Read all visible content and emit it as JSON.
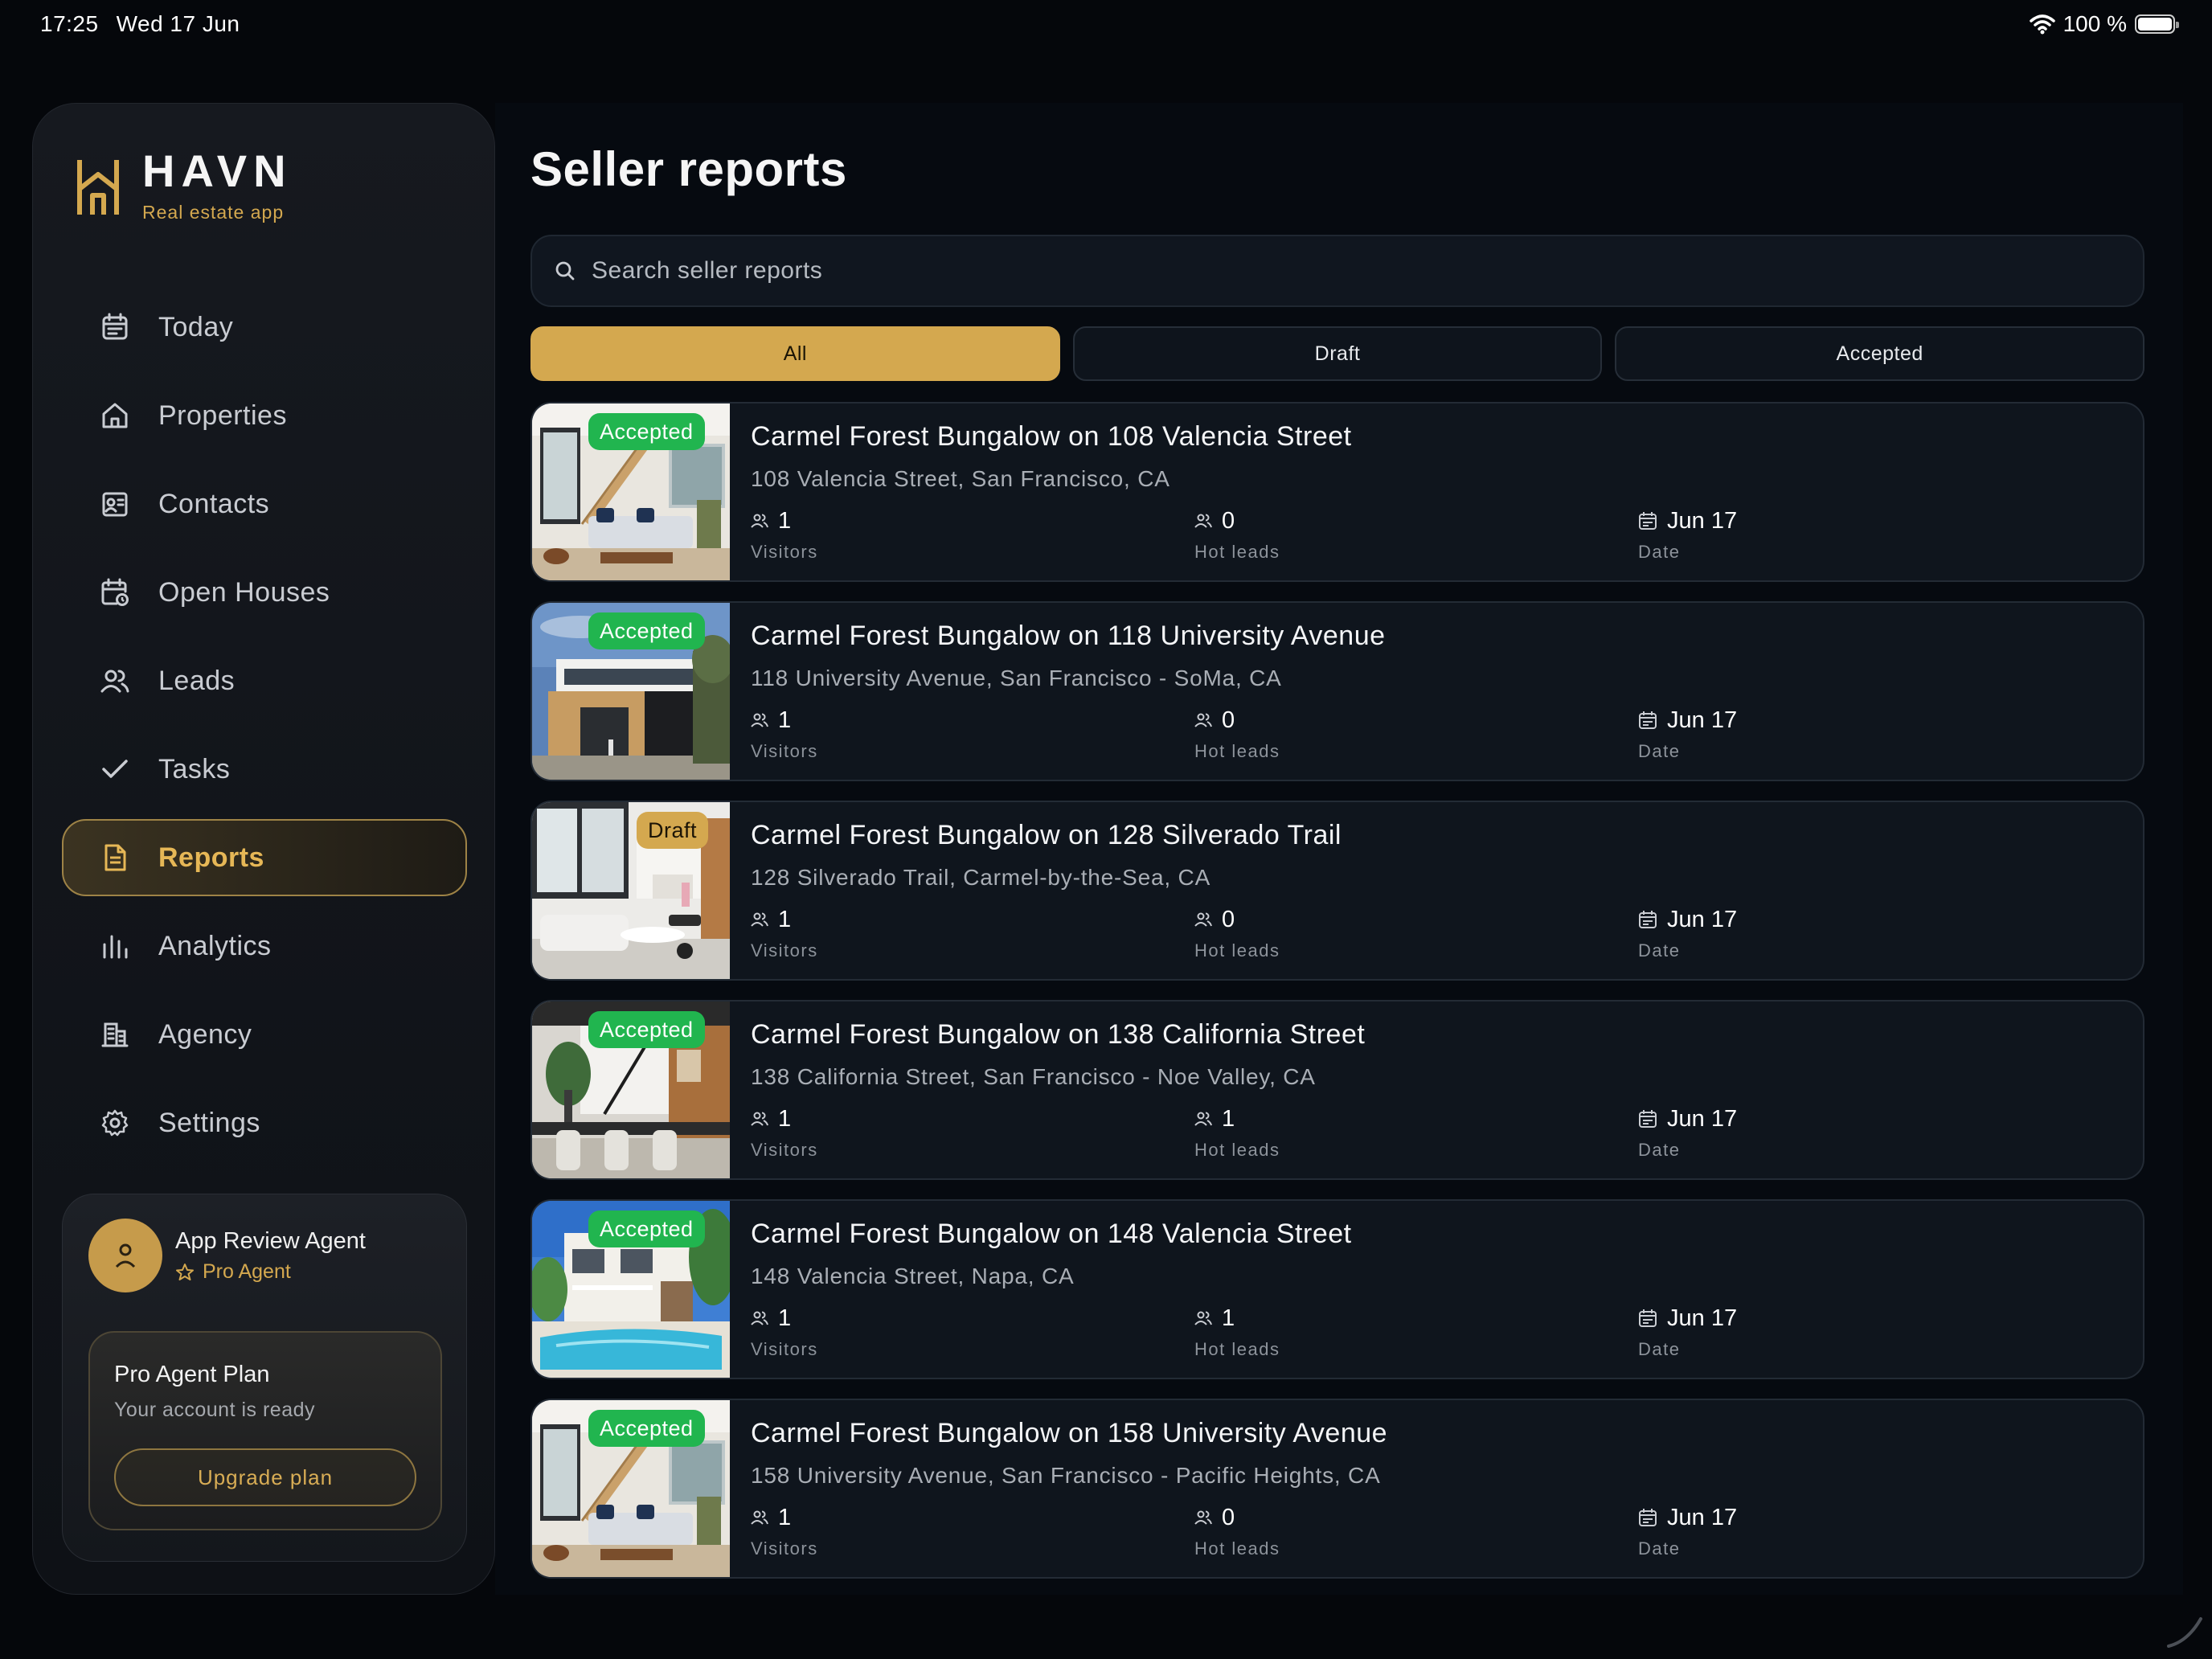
{
  "status_bar": {
    "time": "17:25",
    "date": "Wed 17 Jun",
    "battery": "100 %"
  },
  "brand": {
    "name": "HAVN",
    "tagline": "Real estate app"
  },
  "nav": [
    {
      "label": "Today",
      "icon": "calendar-icon"
    },
    {
      "label": "Properties",
      "icon": "home-icon"
    },
    {
      "label": "Contacts",
      "icon": "contact-card-icon"
    },
    {
      "label": "Open Houses",
      "icon": "calendar-clock-icon"
    },
    {
      "label": "Leads",
      "icon": "users-icon"
    },
    {
      "label": "Tasks",
      "icon": "check-icon"
    },
    {
      "label": "Reports",
      "icon": "document-icon",
      "active": true
    },
    {
      "label": "Analytics",
      "icon": "bar-chart-icon"
    },
    {
      "label": "Agency",
      "icon": "building-icon"
    },
    {
      "label": "Settings",
      "icon": "gear-icon"
    }
  ],
  "account": {
    "name": "App Review Agent",
    "role": "Pro Agent",
    "plan_title": "Pro Agent Plan",
    "plan_subtitle": "Your account is ready",
    "plan_button": "Upgrade plan"
  },
  "main": {
    "title": "Seller reports",
    "search_placeholder": "Search seller reports",
    "tabs": [
      {
        "label": "All",
        "active": true
      },
      {
        "label": "Draft"
      },
      {
        "label": "Accepted"
      }
    ],
    "stat_labels": {
      "visitors": "Visitors",
      "hot_leads": "Hot leads",
      "date": "Date"
    },
    "reports": [
      {
        "status": "Accepted",
        "title": "Carmel Forest Bungalow on 108 Valencia Street",
        "address": "108 Valencia Street, San Francisco, CA",
        "visitors": "1",
        "hot_leads": "0",
        "date": "Jun 17",
        "photo": "interior-staircase-livingroom"
      },
      {
        "status": "Accepted",
        "title": "Carmel Forest Bungalow on 118 University Avenue",
        "address": "118 University Avenue, San Francisco - SoMa, CA",
        "visitors": "1",
        "hot_leads": "0",
        "date": "Jun 17",
        "photo": "modern-house-exterior"
      },
      {
        "status": "Draft",
        "title": "Carmel Forest Bungalow on 128 Silverado Trail",
        "address": "128 Silverado Trail, Carmel-by-the-Sea, CA",
        "visitors": "1",
        "hot_leads": "0",
        "date": "Jun 17",
        "photo": "bright-living-room"
      },
      {
        "status": "Accepted",
        "title": "Carmel Forest Bungalow on 138 California Street",
        "address": "138 California Street, San Francisco - Noe Valley, CA",
        "visitors": "1",
        "hot_leads": "1",
        "date": "Jun 17",
        "photo": "dining-kitchen-interior"
      },
      {
        "status": "Accepted",
        "title": "Carmel Forest Bungalow on 148 Valencia Street",
        "address": "148 Valencia Street, Napa, CA",
        "visitors": "1",
        "hot_leads": "1",
        "date": "Jun 17",
        "photo": "house-with-pool"
      },
      {
        "status": "Accepted",
        "title": "Carmel Forest Bungalow on 158 University Avenue",
        "address": "158 University Avenue, San Francisco - Pacific Heights, CA",
        "visitors": "1",
        "hot_leads": "0",
        "date": "Jun 17",
        "photo": "interior-staircase-livingroom"
      }
    ]
  },
  "colors": {
    "accent_gold": "#d4a84f",
    "accepted_green": "#21b54f",
    "background": "#060a10",
    "card": "#0f151d"
  }
}
